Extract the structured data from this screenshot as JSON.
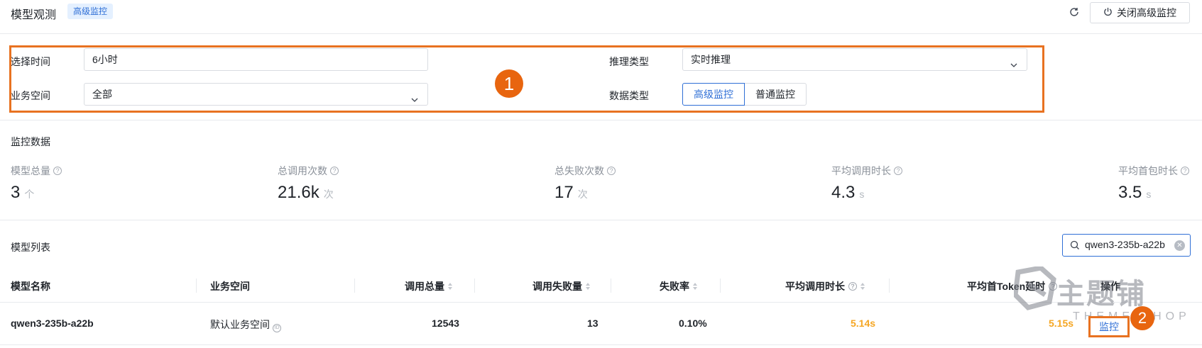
{
  "header": {
    "title": "模型观测",
    "badge": "高级监控",
    "close_button": "关闭高级监控"
  },
  "filters": {
    "time_label": "选择时间",
    "time_value": "6小时",
    "workspace_label": "业务空间",
    "workspace_value": "全部",
    "inference_label": "推理类型",
    "inference_value": "实时推理",
    "data_type_label": "数据类型",
    "data_type_options": [
      "高级监控",
      "普通监控"
    ],
    "data_type_selected": "高级监控"
  },
  "markers": {
    "one": "1",
    "two": "2"
  },
  "stats": {
    "section_title": "监控数据",
    "items": [
      {
        "label": "模型总量",
        "value": "3",
        "unit": "个"
      },
      {
        "label": "总调用次数",
        "value": "21.6k",
        "unit": "次"
      },
      {
        "label": "总失败次数",
        "value": "17",
        "unit": "次"
      },
      {
        "label": "平均调用时长",
        "value": "4.3",
        "unit": "s"
      },
      {
        "label": "平均首包时长",
        "value": "3.5",
        "unit": "s"
      }
    ]
  },
  "table": {
    "section_title": "模型列表",
    "search_value": "qwen3-235b-a22b",
    "columns": [
      "模型名称",
      "业务空间",
      "调用总量",
      "调用失败量",
      "失败率",
      "平均调用时长",
      "平均首Token延时",
      "操作"
    ],
    "rows": [
      {
        "model": "qwen3-235b-a22b",
        "workspace": "默认业务空间",
        "total_calls": "12543",
        "failed_calls": "13",
        "failure_rate": "0.10%",
        "avg_call_time": "5.14s",
        "avg_first_token": "5.15s",
        "action": "监控"
      }
    ]
  },
  "watermark": {
    "text": "主题铺",
    "sub": "THEME SHOP"
  },
  "colors": {
    "accent": "#2f6fd6",
    "highlight": "#e87221",
    "warning": "#f5a623"
  }
}
